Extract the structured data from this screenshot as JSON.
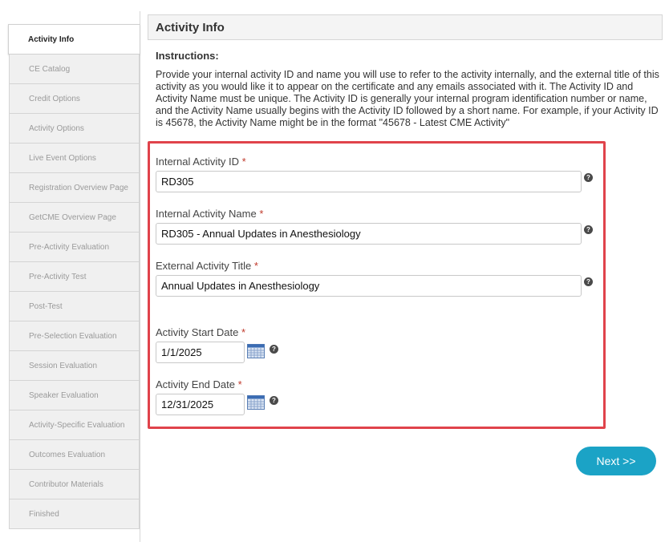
{
  "sidebar": {
    "items": [
      {
        "label": "Activity Info"
      },
      {
        "label": "CE Catalog"
      },
      {
        "label": "Credit Options"
      },
      {
        "label": "Activity Options"
      },
      {
        "label": "Live Event Options"
      },
      {
        "label": "Registration Overview Page"
      },
      {
        "label": "GetCME Overview Page"
      },
      {
        "label": "Pre-Activity Evaluation"
      },
      {
        "label": "Pre-Activity Test"
      },
      {
        "label": "Post-Test"
      },
      {
        "label": "Pre-Selection Evaluation"
      },
      {
        "label": "Session Evaluation"
      },
      {
        "label": "Speaker Evaluation"
      },
      {
        "label": "Activity-Specific Evaluation"
      },
      {
        "label": "Outcomes Evaluation"
      },
      {
        "label": "Contributor Materials"
      },
      {
        "label": "Finished"
      }
    ]
  },
  "header": {
    "title": "Activity Info"
  },
  "instructions": {
    "heading": "Instructions:",
    "text": "Provide your internal activity ID and name you will use to refer to the activity internally, and the external title of this activity as you would like it to appear on the certificate and any emails associated with it. The Activity ID and Activity Name must be unique. The Activity ID is generally your internal program identification number or name, and the Activity Name usually begins with the Activity ID followed by a short name. For example, if your Activity ID is 45678, the Activity Name might be in the format \"45678 - Latest CME Activity\""
  },
  "form": {
    "required_marker": "*",
    "help_glyph": "?",
    "internal_id": {
      "label": "Internal Activity ID",
      "value": "RD305"
    },
    "internal_name": {
      "label": "Internal Activity Name",
      "value": "RD305 - Annual Updates in Anesthesiology"
    },
    "external_title": {
      "label": "External Activity Title",
      "value": "Annual Updates in Anesthesiology"
    },
    "start_date": {
      "label": "Activity Start Date",
      "value": "1/1/2025"
    },
    "end_date": {
      "label": "Activity End Date",
      "value": "12/31/2025"
    }
  },
  "buttons": {
    "next": "Next >>"
  },
  "colors": {
    "highlight": "#e0434b",
    "accent": "#1ba3c6"
  },
  "icons": {
    "help": "help-icon",
    "calendar": "calendar-icon"
  }
}
